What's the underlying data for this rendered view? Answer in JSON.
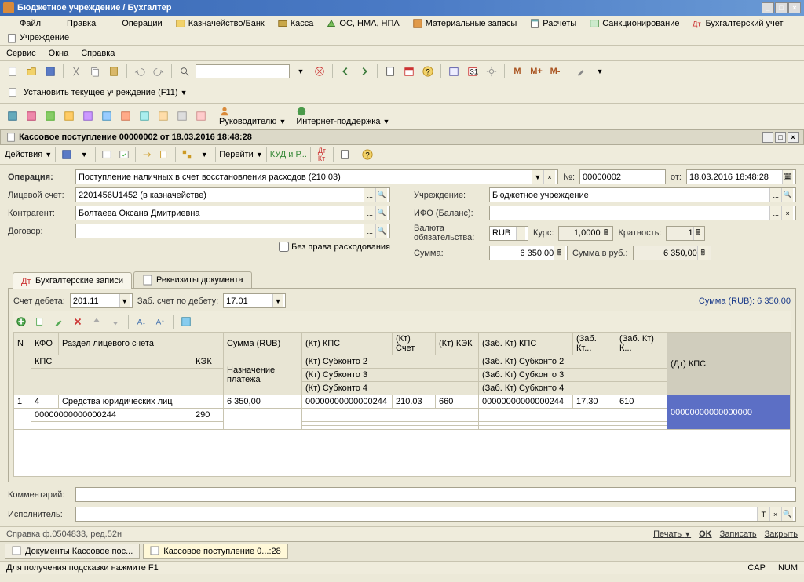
{
  "titlebar": {
    "title": "Бюджетное учреждение / Бухгалтер"
  },
  "menu": {
    "row1": [
      "Файл",
      "Правка",
      "Операции",
      "Казначейство/Банк",
      "Касса",
      "ОС, НМА, НПА",
      "Материальные запасы",
      "Расчеты",
      "Санкционирование",
      "Бухгалтерский учет",
      "Учреждение"
    ],
    "row2": [
      "Сервис",
      "Окна",
      "Справка"
    ]
  },
  "toolbar2": {
    "set_org": "Установить текущее учреждение (F11)"
  },
  "toolbar3": {
    "lead": "Руководителю",
    "support": "Интернет-поддержка"
  },
  "doc": {
    "title": "Кассовое поступление 00000002 от 18.03.2016 18:48:28",
    "actions": "Действия",
    "goto": "Перейти",
    "kudir": "КУД и Р..."
  },
  "form": {
    "operation_lbl": "Операция:",
    "operation_val": "Поступление наличных в счет восстановления расходов (210 03)",
    "num_lbl": "№:",
    "num_val": "00000002",
    "date_lbl": "от:",
    "date_val": "18.03.2016 18:48:28",
    "ls_lbl": "Лицевой счет:",
    "ls_val": "2201456U1452 (в казначействе)",
    "org_lbl": "Учреждение:",
    "org_val": "Бюджетное учреждение",
    "contr_lbl": "Контрагент:",
    "contr_val": "Болтаева Оксана Дмитриевна",
    "ifo_lbl": "ИФО (Баланс):",
    "contract_lbl": "Договор:",
    "currency_lbl": "Валюта обязательства:",
    "currency_val": "RUB",
    "rate_lbl": "Курс:",
    "rate_val": "1,0000",
    "mult_lbl": "Кратность:",
    "mult_val": "1",
    "nopay_lbl": "Без права расходования",
    "sum_lbl": "Сумма:",
    "sum_val": "6 350,00",
    "sumrub_lbl": "Сумма в руб.:",
    "sumrub_val": "6 350,00"
  },
  "tabs": {
    "tab1": "Бухгалтерские записи",
    "tab2": "Реквизиты документа"
  },
  "subform": {
    "debit_lbl": "Счет дебета:",
    "debit_val": "201.11",
    "zab_lbl": "Заб. счет по дебету:",
    "zab_val": "17.01",
    "sumhdr": "Сумма (RUB): 6 350,00"
  },
  "grid": {
    "headers1": [
      "N",
      "КФО",
      "Раздел лицевого счета",
      "",
      "Сумма (RUB)",
      "(Кт) КПС",
      "(Кт) Счет",
      "(Кт) КЭК",
      "(Заб. Кт) КПС",
      "(Заб. Кт...",
      "(Заб. Кт) К...",
      "(Дт) КПС"
    ],
    "headers2": [
      "",
      "КПС",
      "",
      "КЭК",
      "Назначение платежа",
      "(Кт) Субконто 2",
      "",
      "",
      "(Заб. Кт) Субконто 2",
      "",
      "",
      ""
    ],
    "headers3": [
      "",
      "",
      "",
      "",
      "",
      "(Кт) Субконто 3",
      "",
      "",
      "(Заб. Кт) Субконто 3",
      "",
      "",
      ""
    ],
    "headers4": [
      "",
      "",
      "",
      "",
      "",
      "(Кт) Субконто 4",
      "",
      "",
      "(Заб. Кт) Субконто 4",
      "",
      "",
      ""
    ],
    "data1": [
      "1",
      "4",
      "Средства юридических лиц",
      "",
      "6 350,00",
      "00000000000000244",
      "210.03",
      "660",
      "00000000000000244",
      "17.30",
      "610",
      "00000000000000000"
    ],
    "data2": [
      "",
      "00000000000000244",
      "",
      "290",
      "",
      "",
      "",
      "",
      "",
      "",
      "",
      ""
    ]
  },
  "bottom": {
    "comment_lbl": "Комментарий:",
    "exec_lbl": "Исполнитель:"
  },
  "footer": {
    "ref": "Справка ф.0504833, ред.52н",
    "print": "Печать",
    "ok": "OK",
    "save": "Записать",
    "close": "Закрыть"
  },
  "tasks": {
    "t1": "Документы Кассовое пос...",
    "t2": "Кассовое поступление 0...:28"
  },
  "status": {
    "hint": "Для получения подсказки нажмите F1",
    "cap": "CAP",
    "num": "NUM"
  }
}
